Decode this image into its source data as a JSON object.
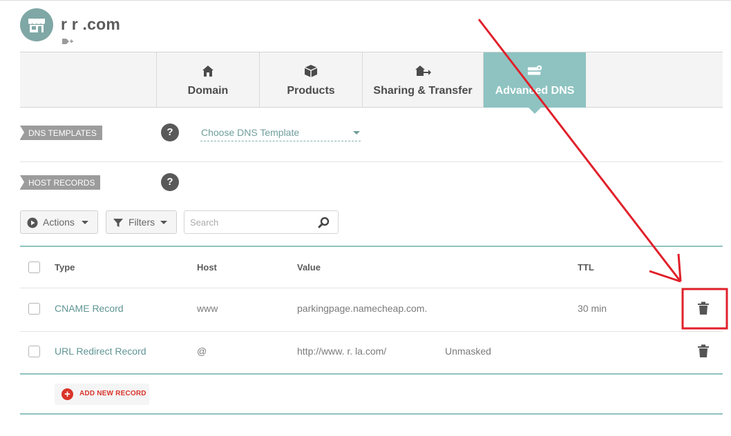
{
  "header": {
    "domain_name": "r    r    .com"
  },
  "tabs": [
    {
      "label": "Domain",
      "icon": "home-icon",
      "active": false
    },
    {
      "label": "Products",
      "icon": "box-icon",
      "active": false
    },
    {
      "label": "Sharing & Transfer",
      "icon": "house-transfer-icon",
      "active": false
    },
    {
      "label": "Advanced DNS",
      "icon": "server-gear-icon",
      "active": true
    }
  ],
  "dns_templates": {
    "section_label": "DNS TEMPLATES",
    "help": "?",
    "select_value": "Choose DNS Template"
  },
  "host_records": {
    "section_label": "HOST RECORDS",
    "help": "?",
    "toolbar": {
      "actions_label": "Actions",
      "filters_label": "Filters",
      "search_placeholder": "Search"
    },
    "columns": [
      "Type",
      "Host",
      "Value",
      "TTL"
    ],
    "rows": [
      {
        "type": "CNAME Record",
        "host": "www",
        "value": "parkingpage.namecheap.com.",
        "extra": "",
        "ttl": "30 min"
      },
      {
        "type": "URL Redirect Record",
        "host": "@",
        "value": "http://www.    r.     la.com/",
        "extra": "Unmasked",
        "ttl": ""
      }
    ],
    "add_label": "ADD NEW RECORD"
  },
  "colors": {
    "accent_teal": "#8ec3c1",
    "danger_red": "#d9332a",
    "annotation_red": "#e0202a"
  }
}
